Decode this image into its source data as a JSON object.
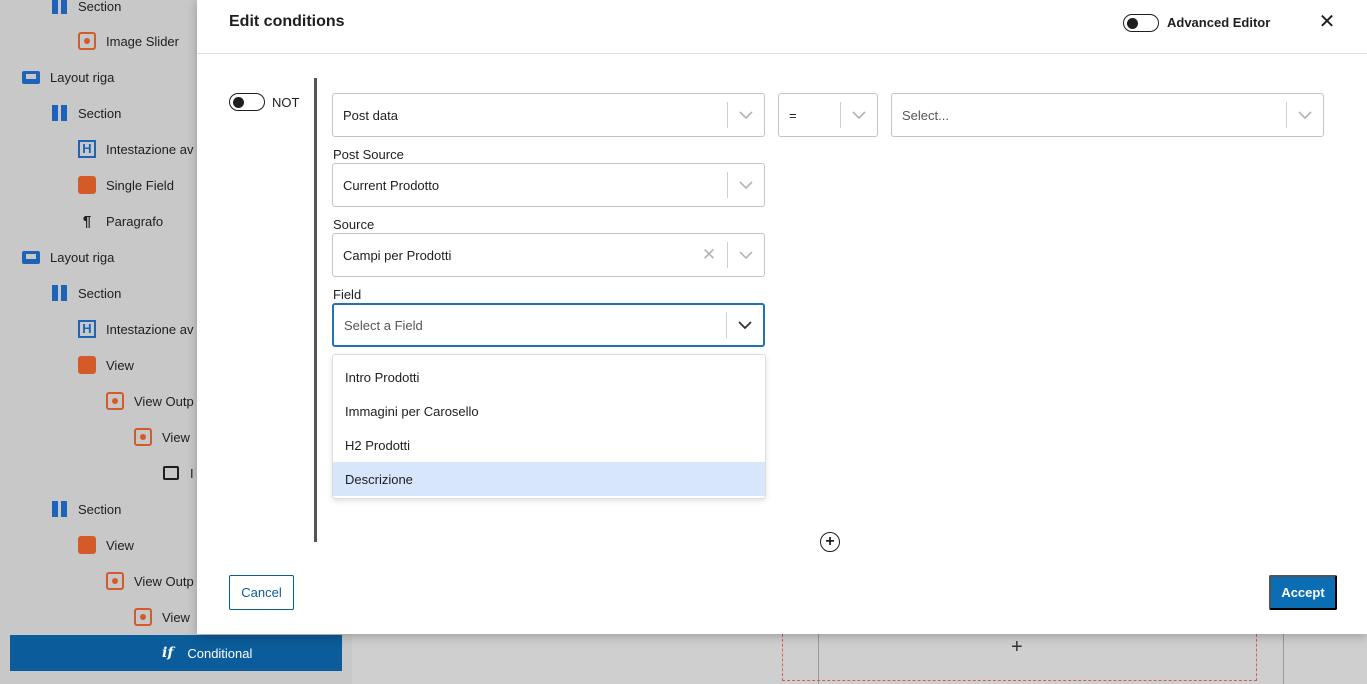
{
  "background": {
    "list_items": [
      {
        "label": "Section",
        "icon": "section-icon"
      },
      {
        "label": "Image Slider",
        "icon": "image-slider-icon"
      },
      {
        "label": "Layout riga",
        "icon": "layout-row-icon"
      },
      {
        "label": "Section",
        "icon": "section-icon"
      },
      {
        "label": "Intestazione av",
        "icon": "heading-icon"
      },
      {
        "label": "Single Field",
        "icon": "single-field-icon"
      },
      {
        "label": "Paragrafo",
        "icon": "paragraph-icon"
      },
      {
        "label": "Layout riga",
        "icon": "layout-row-icon"
      },
      {
        "label": "Section",
        "icon": "section-icon"
      },
      {
        "label": "Intestazione av",
        "icon": "heading-icon"
      },
      {
        "label": "View",
        "icon": "view-icon"
      },
      {
        "label": "View Outp",
        "icon": "view-output-icon"
      },
      {
        "label": "View",
        "icon": "view-loop-icon"
      },
      {
        "label": "I",
        "icon": "image-icon"
      },
      {
        "label": "Section",
        "icon": "section-icon"
      },
      {
        "label": "View",
        "icon": "view-icon"
      },
      {
        "label": "View Outp",
        "icon": "view-output-icon"
      },
      {
        "label": "View",
        "icon": "view-loop-icon"
      }
    ],
    "selected_item": {
      "label": "Conditional",
      "icon": "conditional-icon"
    },
    "canvas_add": "+"
  },
  "modal": {
    "title": "Edit conditions",
    "advanced_editor_label": "Advanced Editor",
    "close_glyph": "✕",
    "not_label": "NOT",
    "condition": {
      "type_select": {
        "value": "Post data"
      },
      "operator_select": {
        "value": "="
      },
      "value_select": {
        "placeholder": "Select..."
      },
      "post_source": {
        "label": "Post Source",
        "value": "Current Prodotto"
      },
      "source": {
        "label": "Source",
        "value": "Campi per Prodotti"
      },
      "field": {
        "label": "Field",
        "placeholder": "Select a Field"
      },
      "field_options": [
        "Intro Prodotti",
        "Immagini per Carosello",
        "H2 Prodotti",
        "Descrizione"
      ],
      "highlighted_option": "Descrizione"
    },
    "add_condition_glyph": "+",
    "cancel_label": "Cancel",
    "accept_label": "Accept"
  },
  "colors": {
    "accent": "#0b6db3",
    "focus_border": "#2271b1",
    "highlight": "#d7e6fb",
    "block_blue": "#1d63b8",
    "block_orange": "#d45a2a"
  }
}
